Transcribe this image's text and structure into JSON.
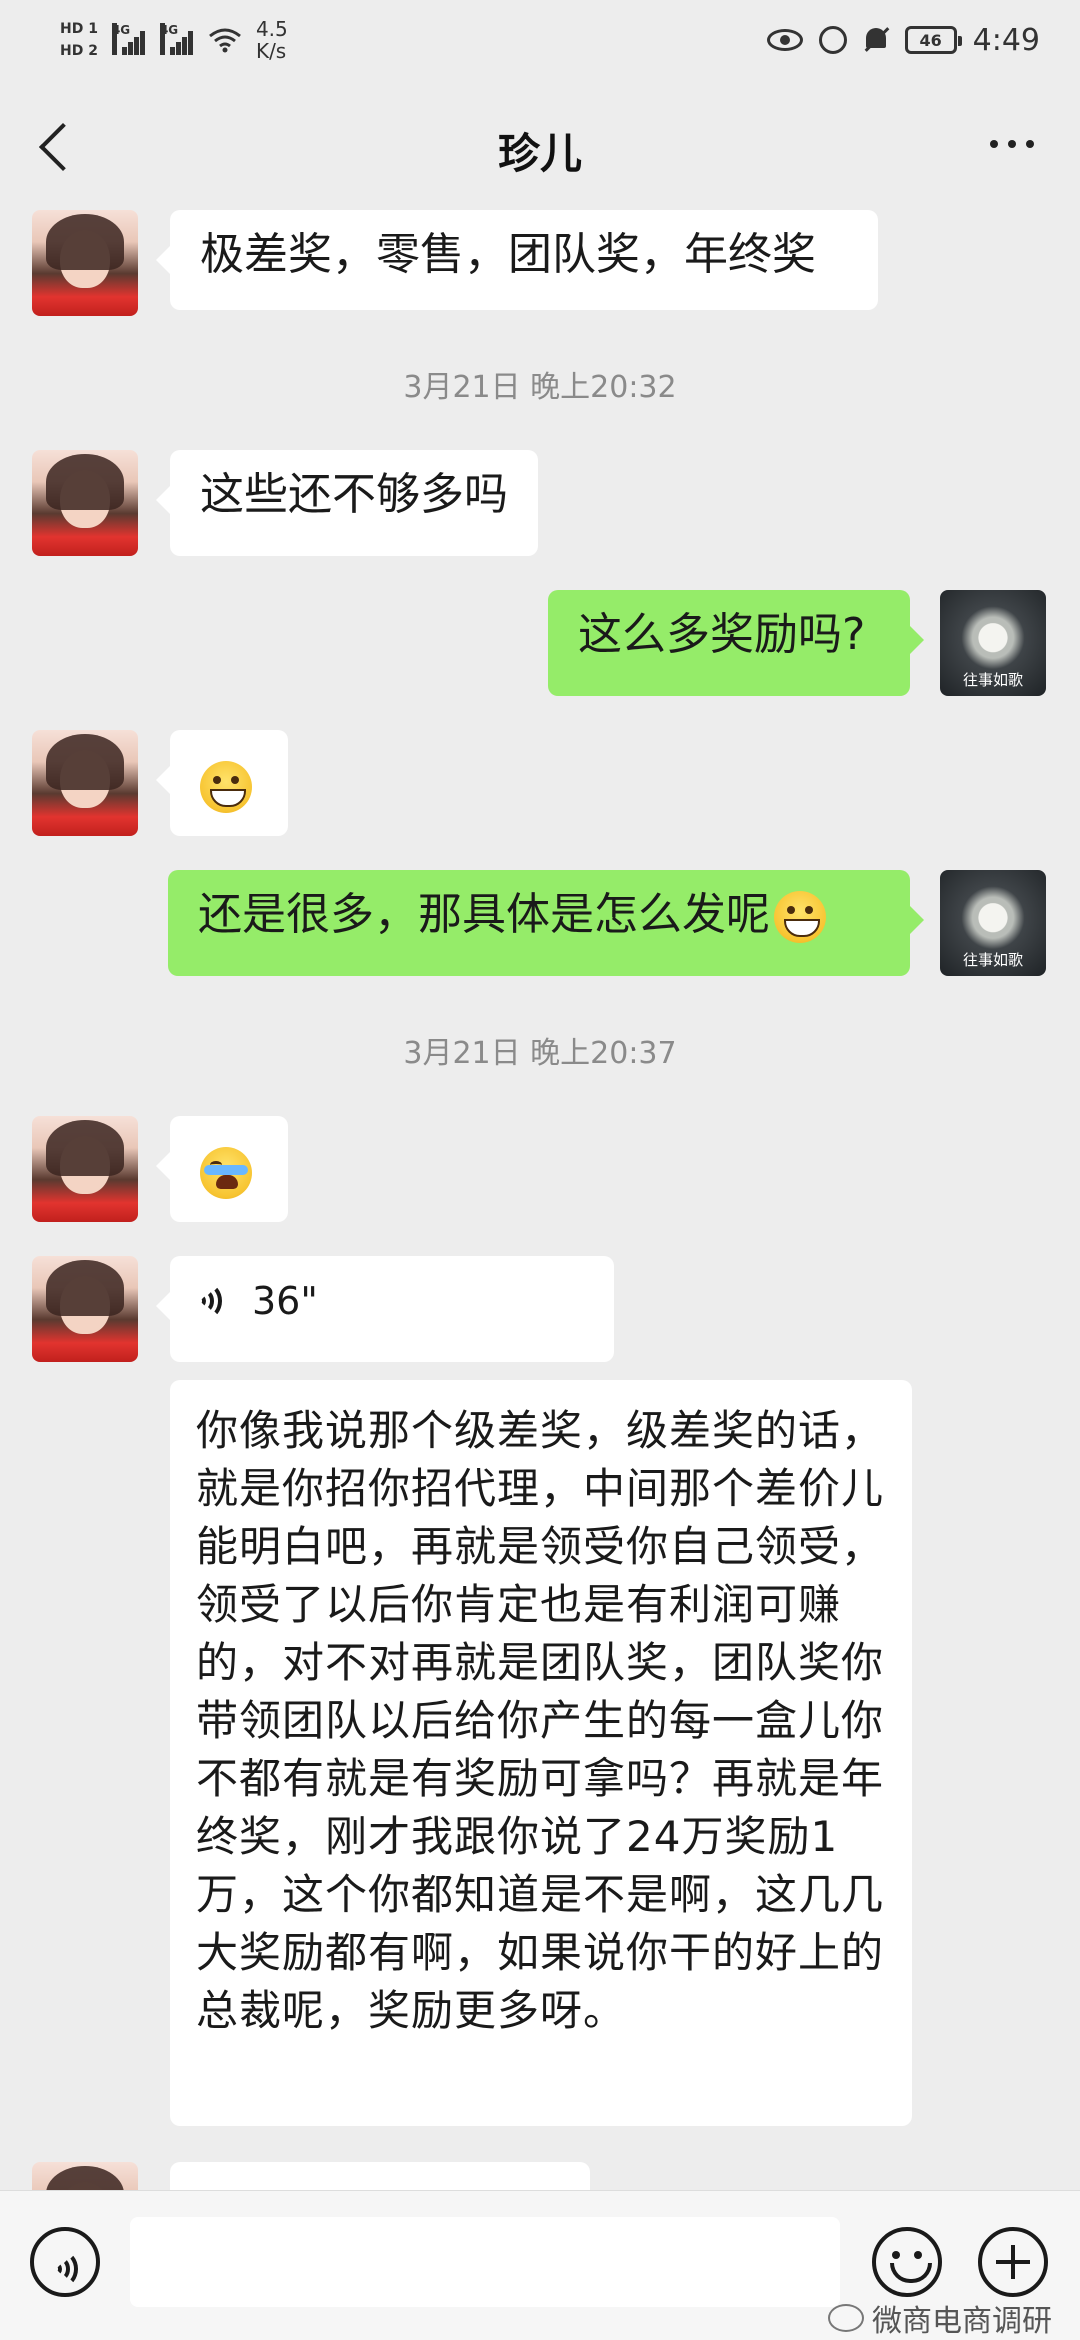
{
  "status_bar": {
    "hd1": "HD 1",
    "hd2": "HD 2",
    "net1": "4G",
    "net2": "4G",
    "speed_value": "4.5",
    "speed_unit": "K/s",
    "battery": "46",
    "time": "4:49"
  },
  "header": {
    "title": "珍儿"
  },
  "messages": [
    {
      "side": "left",
      "text": "极差奖，零售，团队奖，年终奖"
    },
    {
      "timestamp": "3月21日 晚上20:32"
    },
    {
      "side": "left",
      "text": "这些还不够多吗"
    },
    {
      "side": "right",
      "text": "这么多奖励吗?"
    },
    {
      "side": "left",
      "emoji": "grinning-face-emoji"
    },
    {
      "side": "right",
      "text": "还是很多，那具体是怎么发呢"
    },
    {
      "timestamp": "3月21日 晚上20:37"
    },
    {
      "side": "left",
      "emoji": "crying-laughing-emoji"
    },
    {
      "side": "left",
      "voice_duration": "36\""
    },
    {
      "side": "left",
      "text": "你像我说那个级差奖，级差奖的话，就是你招你招代理，中间那个差价儿能明白吧，再就是领受你自己领受，领受了以后你肯定也是有利润可赚的，对不对再就是团队奖，团队奖你带领团队以后给你产生的每一盒儿你不都有就是有奖励可拿吗？再就是年终奖，刚才我跟你说了24万奖励1万，这个你都知道是不是啊，这几几大奖励都有啊，如果说你干的好上的总裁呢，奖励更多呀。"
    }
  ],
  "my_avatar_caption": "往事如歌",
  "watermark": "微商电商调研",
  "colors": {
    "background": "#ededed",
    "sent_bubble": "#95ec69",
    "received_bubble": "#ffffff"
  }
}
